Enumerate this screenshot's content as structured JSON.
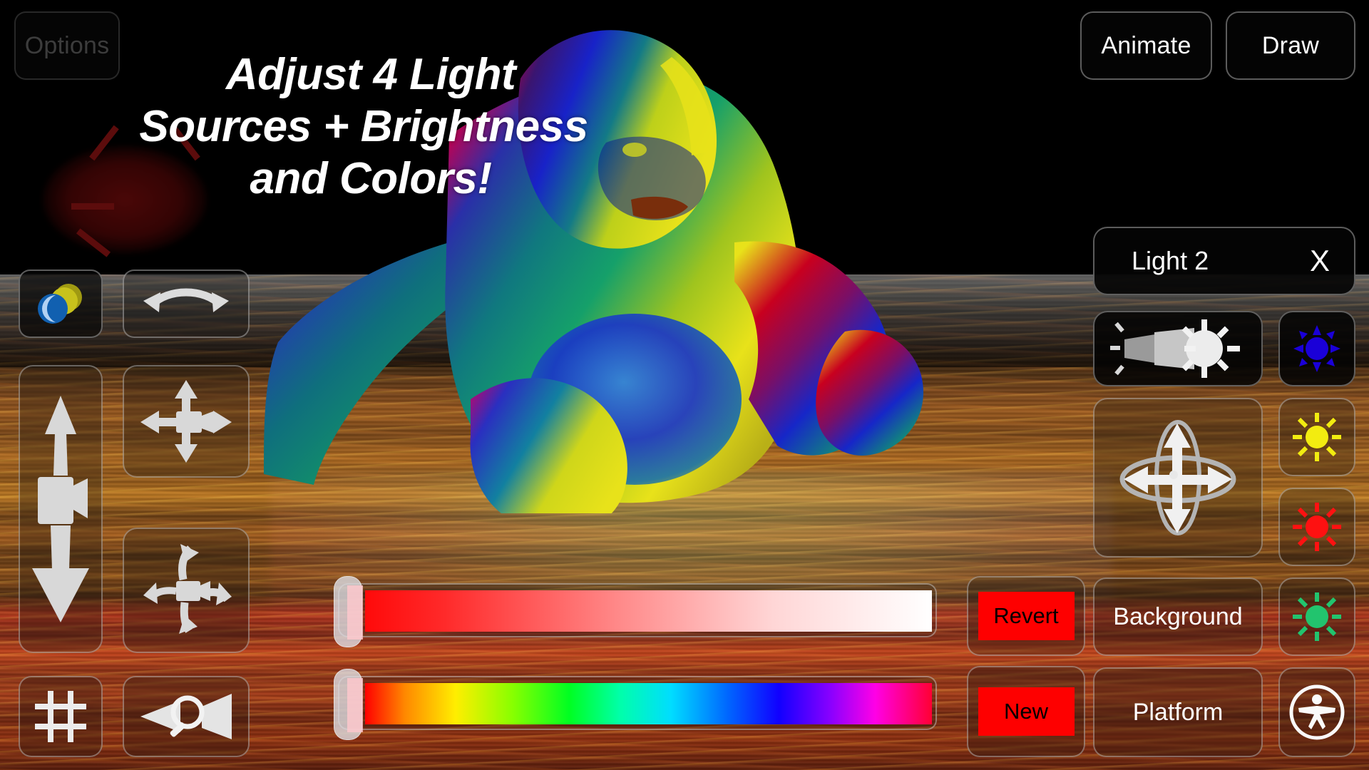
{
  "app": {
    "title": "Adjust 4 Light Sources + Brightness and Colors!",
    "headline_line1": "Adjust 4 Light",
    "headline_line2": "Sources + Brightness",
    "headline_line3": "and Colors!"
  },
  "top_bar": {
    "options_label": "Options",
    "options_state": "disabled",
    "animate_label": "Animate",
    "draw_label": "Draw"
  },
  "left_tools": [
    {
      "name": "material-spheres",
      "icon": "two-spheres-icon",
      "label": ""
    },
    {
      "name": "rotate-scene",
      "icon": "curved-double-arrow-icon",
      "label": ""
    },
    {
      "name": "camera-elevate",
      "icon": "camera-up-down-icon",
      "label": ""
    },
    {
      "name": "camera-pan",
      "icon": "camera-four-way-arrows-icon",
      "label": ""
    },
    {
      "name": "camera-orbit",
      "icon": "camera-curved-arrows-icon",
      "label": ""
    },
    {
      "name": "grid-toggle",
      "icon": "grid-icon",
      "label": ""
    },
    {
      "name": "camera-zoom",
      "icon": "magnifier-lens-icon",
      "label": ""
    }
  ],
  "light_panel": {
    "title": "Light 2",
    "close_label": "X",
    "light_type_icon": "spotlight-beam-icon",
    "move_icon": "orbit-move-icon",
    "swatches": [
      {
        "name": "color-blue",
        "icon": "sun-icon",
        "color": "#1a00d8"
      },
      {
        "name": "color-yellow",
        "icon": "sun-icon",
        "color": "#f2ec10"
      },
      {
        "name": "color-red",
        "icon": "sun-icon",
        "color": "#fe1111"
      },
      {
        "name": "color-green",
        "icon": "sun-icon",
        "color": "#22c46e"
      }
    ],
    "background_label": "Background",
    "platform_label": "Platform",
    "accessibility_icon": "accessibility-person-icon"
  },
  "actions": {
    "revert_label": "Revert",
    "new_label": "New",
    "button_color": "#fe0000",
    "button_text_color": "#000000"
  },
  "sliders": [
    {
      "name": "brightness-slider",
      "kind": "brightness",
      "value_percent": 0,
      "gradient_from": "#ff0a0a",
      "gradient_to": "#ffffff"
    },
    {
      "name": "hue-slider",
      "kind": "hue",
      "value_percent": 0,
      "gradient_from": "#ff0000",
      "gradient_to": "#ff0033"
    }
  ],
  "scene": {
    "model": "gorilla-3d-model",
    "sky_color": "#000000",
    "ground": "lava-reflective-platform",
    "beam_color": "#c40808",
    "model_light_colors": [
      "#1a2fd0",
      "#e8e21a",
      "#16a06a",
      "#e0104a"
    ]
  }
}
